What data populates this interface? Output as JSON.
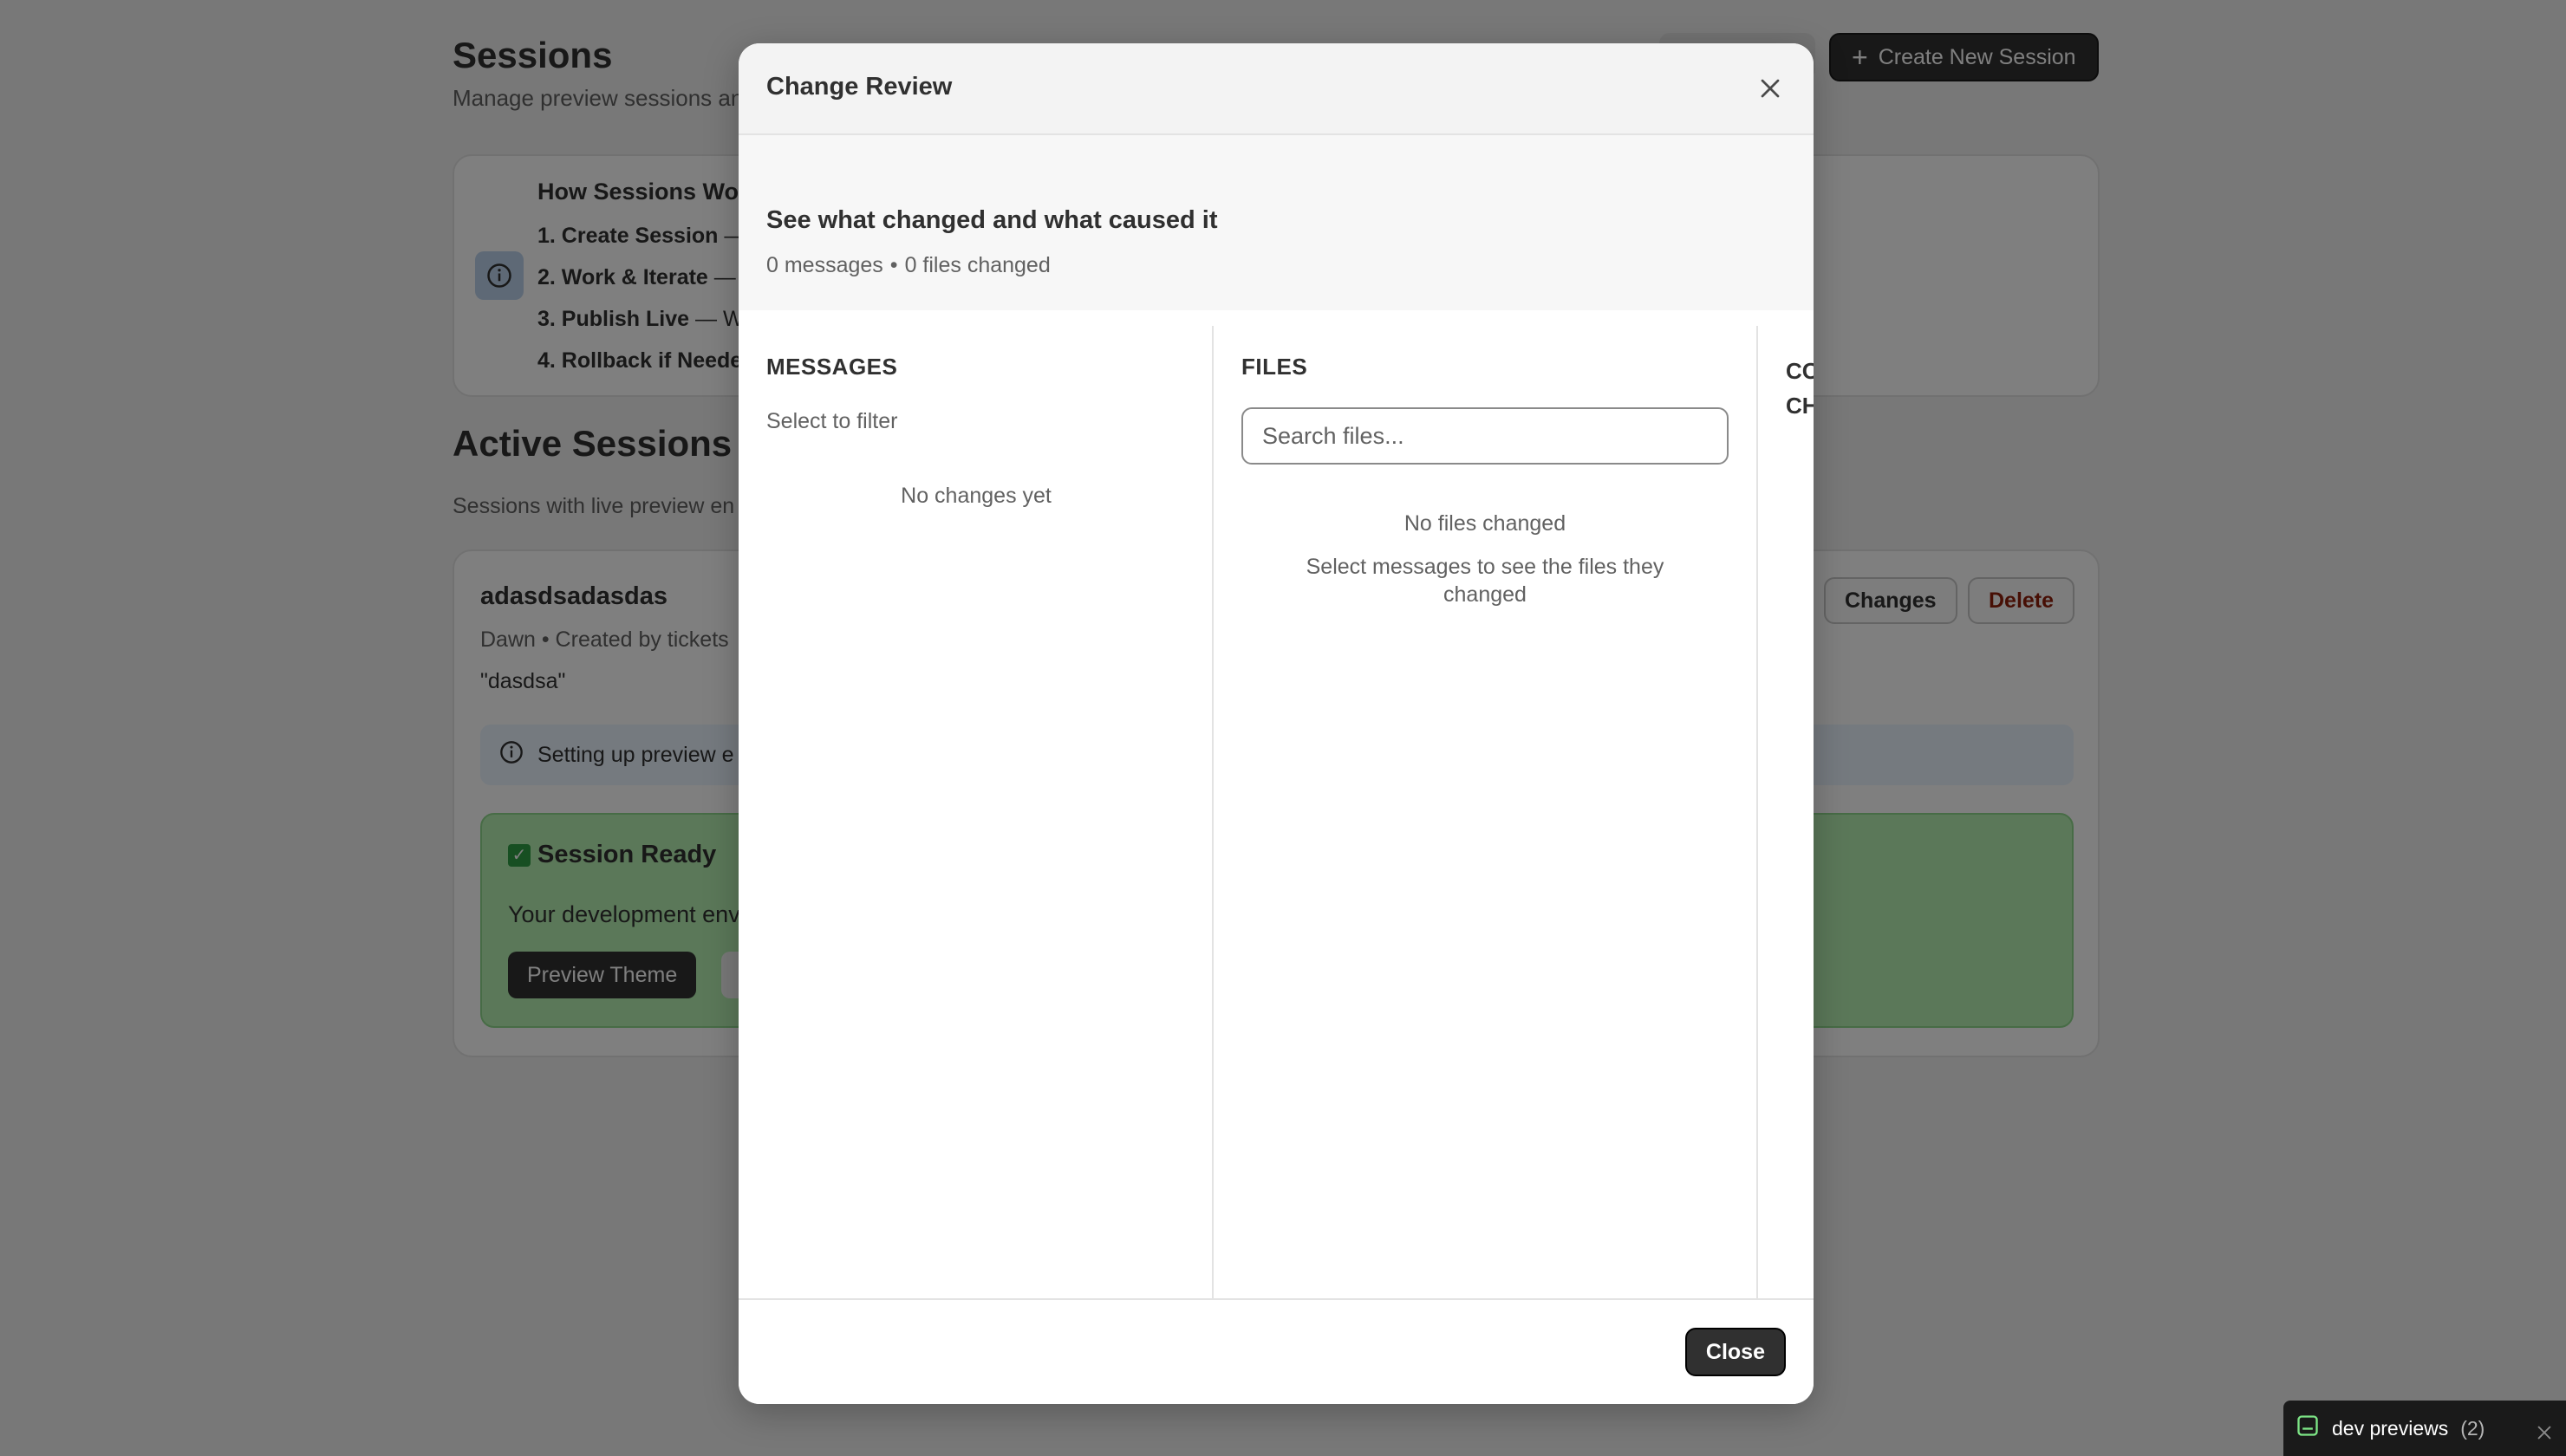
{
  "page": {
    "title": "Sessions",
    "subtitle": "Manage preview sessions an",
    "create_button_label": "Create New Session",
    "how_it_works": {
      "title": "How Sessions Wor",
      "steps": [
        {
          "bold": "1. Create Session",
          "rest": " — "
        },
        {
          "bold": "2. Work & Iterate",
          "rest": " — "
        },
        {
          "bold": "3. Publish Live",
          "rest": " — Wh"
        },
        {
          "bold": "4. Rollback if Neede",
          "rest": ""
        }
      ]
    },
    "active_sessions_title": "Active Sessions",
    "active_sessions_subtitle": "Sessions with live preview en",
    "session": {
      "name": "adasdsadasdas",
      "meta": "Dawn • Created by tickets",
      "description": "\"dasdsa\"",
      "changes_label": "Changes",
      "delete_label": "Delete",
      "banner_text": "Setting up preview e",
      "ready_title": "Session Ready",
      "ready_text": "Your development env",
      "preview_button_label": "Preview Theme"
    }
  },
  "modal": {
    "title": "Change Review",
    "heading": "See what changed and what caused it",
    "messages_count": "0 messages",
    "separator": "•",
    "files_count": "0 files changed",
    "messages_column": {
      "heading": "MESSAGES",
      "hint": "Select to filter",
      "empty": "No changes yet"
    },
    "files_column": {
      "heading": "FILES",
      "search_placeholder": "Search files...",
      "empty_title": "No files changed",
      "empty_sub": "Select messages to see the files they changed"
    },
    "context_column": {
      "heading_line1": "CO",
      "heading_line2": "CH"
    },
    "close_label": "Close"
  },
  "dev_bar": {
    "label": "dev previews",
    "count": "(2)"
  },
  "icons": {
    "info": "info-icon",
    "close": "close-icon",
    "plus": "plus-icon",
    "check": "checkbox-icon",
    "dev": "terminal-icon"
  },
  "colors": {
    "primary": "#303030",
    "ready_bg": "#b6f0b3",
    "info_banner": "#eaf4ff",
    "delete_text": "#8e1f0b"
  }
}
